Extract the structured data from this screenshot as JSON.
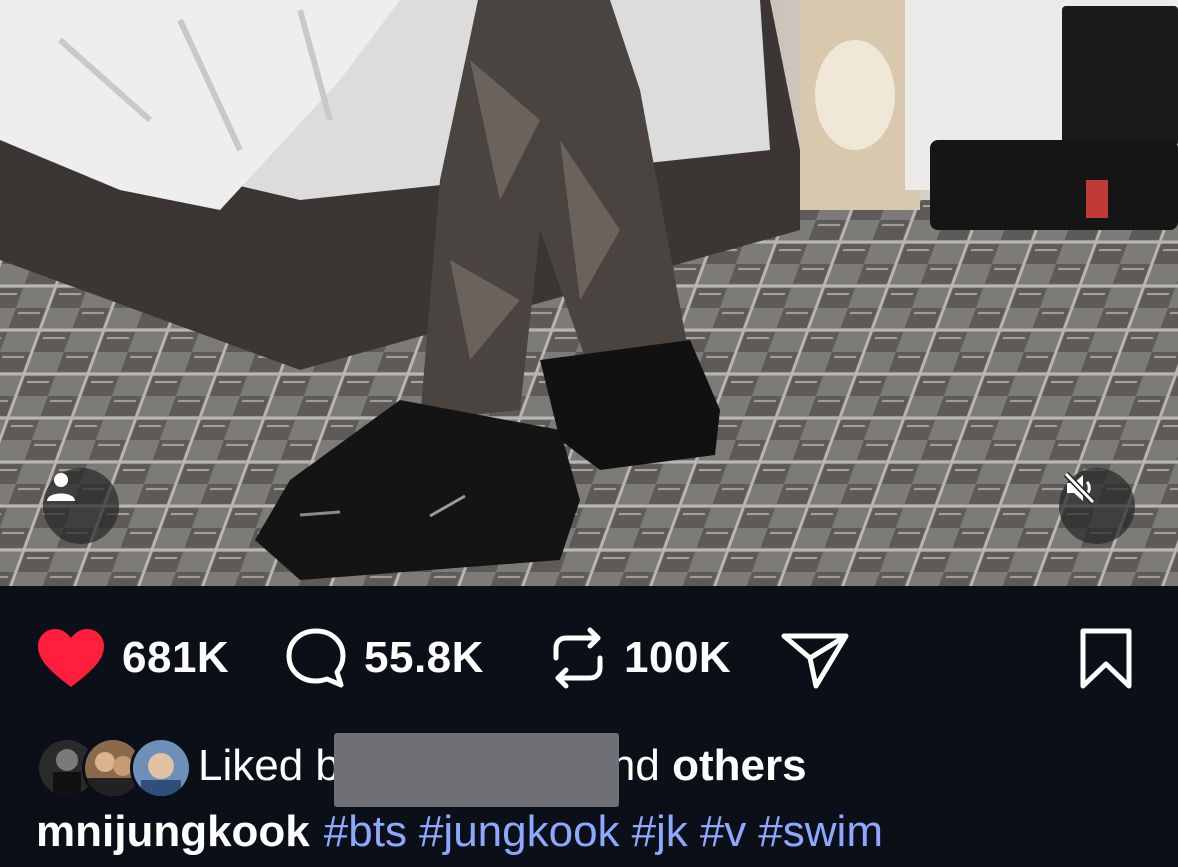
{
  "media": {
    "tag_icon": "person-icon",
    "mute_icon": "speaker-muted-icon"
  },
  "actions": {
    "likes": "681K",
    "comments": "55.8K",
    "reposts": "100K",
    "like_color": "#ff1f3d",
    "icons": [
      "heart-icon",
      "comment-icon",
      "repost-icon",
      "share-icon",
      "bookmark-icon"
    ]
  },
  "liked_by": {
    "prefix": "Liked b",
    "suffix": "nd ",
    "others": "others"
  },
  "caption": {
    "username": "mnijungkook",
    "hashtags": [
      "#bts",
      "#jungkook",
      "#jk",
      "#v",
      "#swim"
    ],
    "hashtag_color": "#8fa8ff"
  }
}
